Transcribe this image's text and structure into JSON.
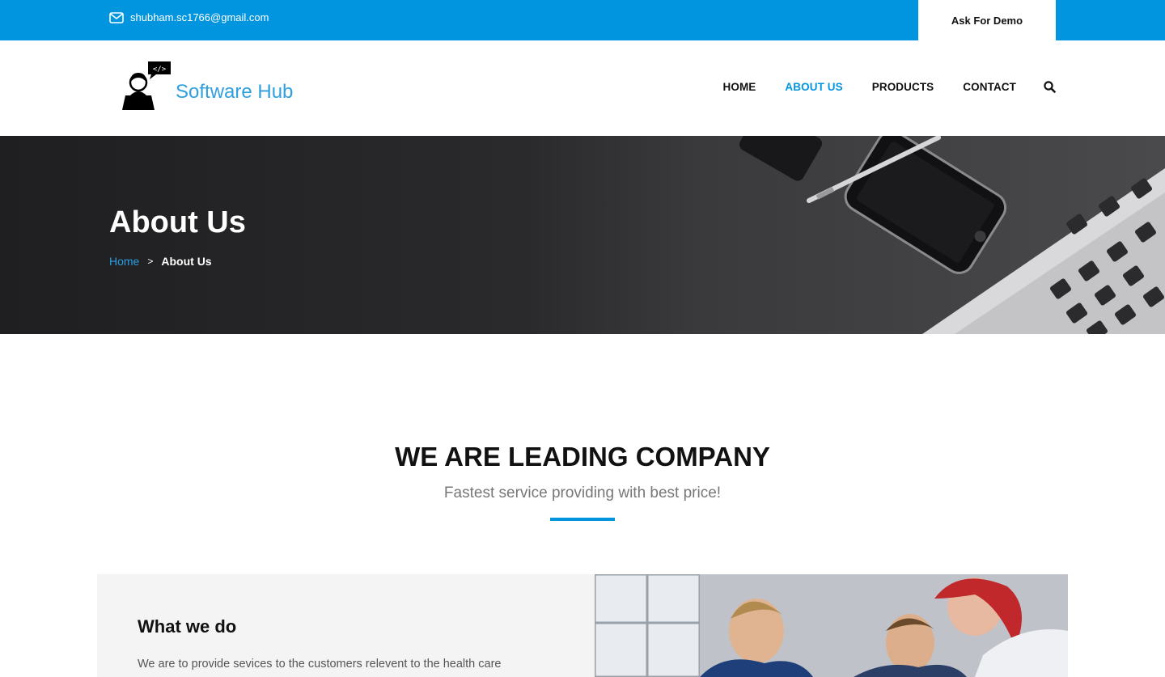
{
  "topbar": {
    "email": "shubham.sc1766@gmail.com",
    "email_icon": "envelope-icon",
    "demo_label": "Ask For Demo",
    "bg_color": "#0195e0"
  },
  "header": {
    "brand": "Software Hub",
    "logo_icon": "developer-avatar-icon",
    "nav": [
      {
        "label": "HOME",
        "active": false
      },
      {
        "label": "ABOUT US",
        "active": true
      },
      {
        "label": "PRODUCTS",
        "active": false
      },
      {
        "label": "CONTACT",
        "active": false
      }
    ],
    "search_icon": "search-icon"
  },
  "hero": {
    "title": "About Us",
    "breadcrumb": {
      "home": "Home",
      "separator": ">",
      "current": "About Us"
    }
  },
  "intro": {
    "title": "WE ARE LEADING COMPANY",
    "subtitle": "Fastest service providing with best price!"
  },
  "what_we_do": {
    "title": "What we do",
    "text": "We are to provide sevices to the customers relevent to the health care"
  },
  "colors": {
    "accent": "#0195e0",
    "link": "#2a9fe6",
    "brand": "#2f9fe0"
  }
}
